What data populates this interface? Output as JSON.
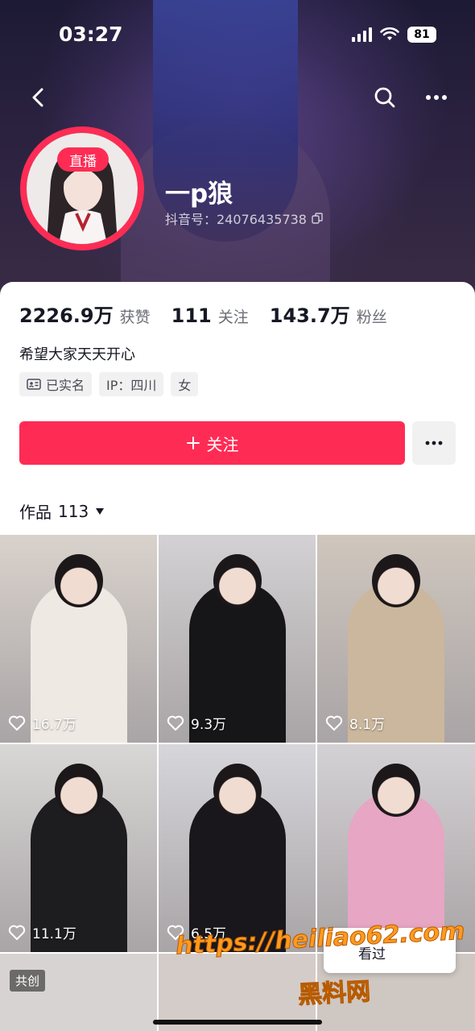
{
  "status_bar": {
    "time": "03:27",
    "battery": "81"
  },
  "profile": {
    "live_badge": "直播",
    "name": "一p狼",
    "douyin_id": "抖音号：24076435738",
    "stats": [
      {
        "value": "2226.9万",
        "label": "获赞"
      },
      {
        "value": "111",
        "label": "关注"
      },
      {
        "value": "143.7万",
        "label": "粉丝"
      }
    ],
    "bio": "希望大家天天开心",
    "tags": [
      "已实名",
      "IP：四川",
      "女"
    ]
  },
  "actions": {
    "follow_label": "关注"
  },
  "works": {
    "label": "作品",
    "count": "113"
  },
  "videos": [
    {
      "likes": "16.7万",
      "bg": "#d9d2cc",
      "outfit": "#efe9e4"
    },
    {
      "likes": "9.3万",
      "bg": "#d3d1d3",
      "outfit": "#161618"
    },
    {
      "likes": "8.1万",
      "bg": "#cfc6bd",
      "outfit": "#cbb79d"
    },
    {
      "likes": "11.1万",
      "bg": "#d9d7d6",
      "outfit": "#1d1c1f"
    },
    {
      "likes": "6.5万",
      "bg": "#d6d6db",
      "outfit": "#19171b"
    },
    {
      "likes": "",
      "bg": "#d4d1d4",
      "outfit": "#e7a6c3"
    }
  ],
  "bottom_row": {
    "cocreate_label": "共创"
  },
  "watermark": {
    "url": "https://heiliao62.com",
    "name": "黑料网",
    "box_text": "看过"
  },
  "colors": {
    "accent": "#fe2c55"
  }
}
